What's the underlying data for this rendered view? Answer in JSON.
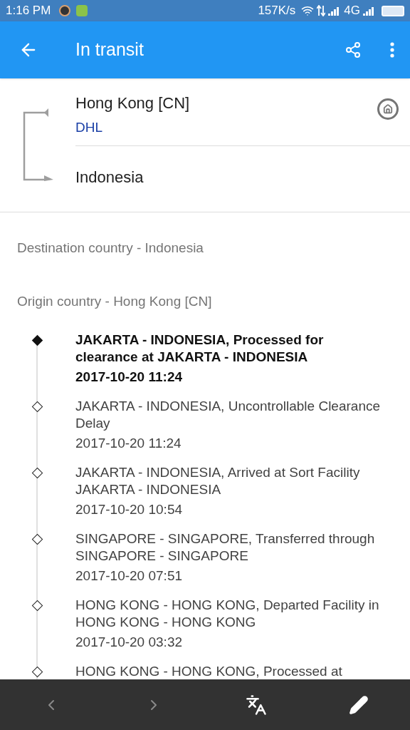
{
  "status_bar": {
    "time": "1:16 PM",
    "speed": "157K/s",
    "network": "4G"
  },
  "app_bar": {
    "title": "In transit"
  },
  "route": {
    "origin": "Hong Kong [CN]",
    "carrier": "DHL",
    "destination": "Indonesia"
  },
  "destination_note": "Destination country - Indonesia",
  "origin_note": "Origin country - Hong Kong [CN]",
  "events": [
    {
      "text": "JAKARTA - INDONESIA, Processed for clearance at JAKARTA - INDONESIA",
      "time": "2017-10-20 11:24",
      "current": true
    },
    {
      "text": "JAKARTA - INDONESIA, Uncontrollable Clearance Delay",
      "time": "2017-10-20 11:24",
      "current": false
    },
    {
      "text": "JAKARTA - INDONESIA, Arrived at Sort Facility JAKARTA - INDONESIA",
      "time": "2017-10-20 10:54",
      "current": false
    },
    {
      "text": "SINGAPORE - SINGAPORE, Transferred through SINGAPORE - SINGAPORE",
      "time": "2017-10-20 07:51",
      "current": false
    },
    {
      "text": "HONG KONG - HONG KONG, Departed Facility in HONG KONG - HONG KONG",
      "time": "2017-10-20 03:32",
      "current": false
    },
    {
      "text": "HONG KONG - HONG KONG, Processed at",
      "current": false
    }
  ],
  "bottom_bar": {
    "back_disabled": true,
    "forward_disabled": true
  }
}
